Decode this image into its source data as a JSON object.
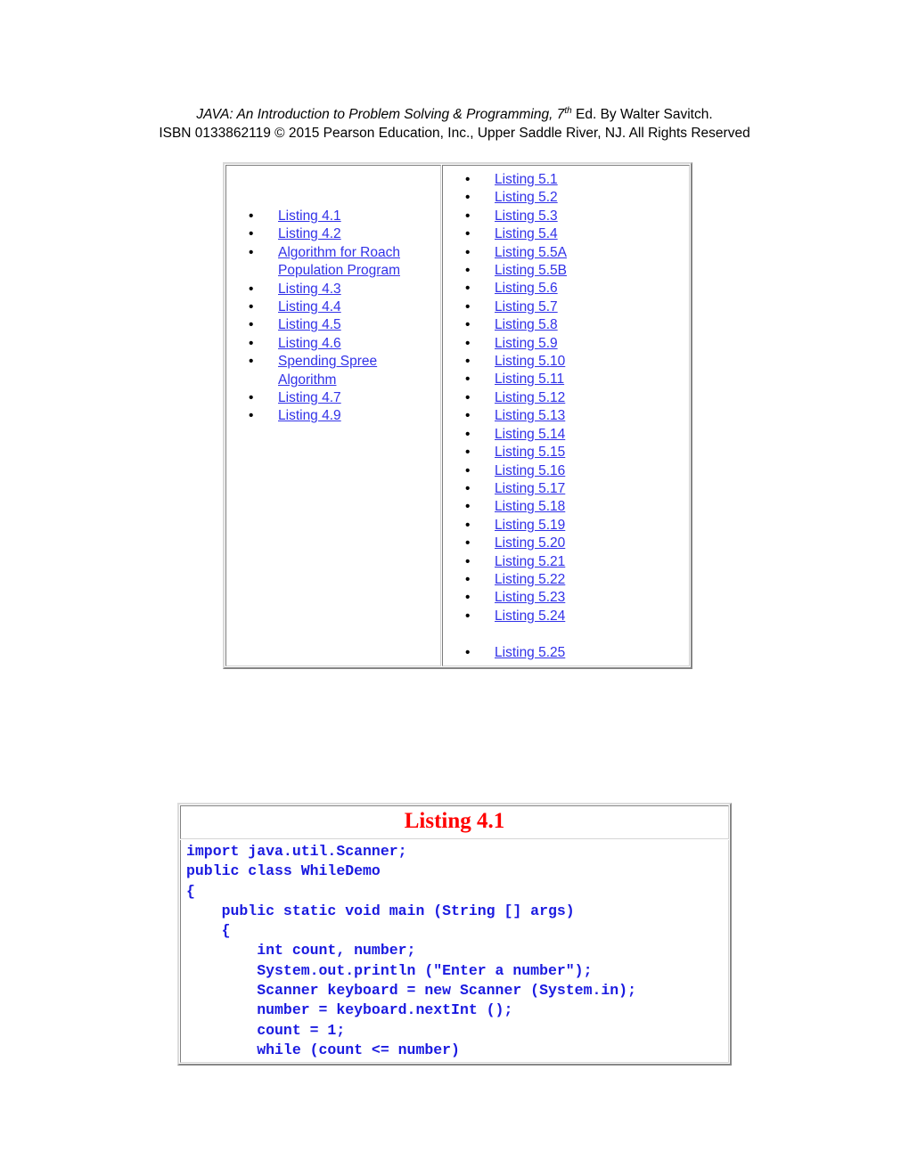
{
  "header": {
    "line1_italic": "JAVA: An Introduction to Problem Solving & Programming,",
    "line1_edition_num": "7",
    "line1_edition_sup": "th",
    "line1_tail": " Ed. By Walter Savitch.",
    "line2": "ISBN 0133862119 © 2015 Pearson Education, Inc., Upper Saddle River, NJ. All Rights Reserved"
  },
  "listings_table": {
    "left_column": [
      {
        "label": "Listing 4.1",
        "bullet": true
      },
      {
        "label": "Listing 4.2",
        "bullet": true
      },
      {
        "label": "Algorithm for Roach Population Program",
        "bullet": true
      },
      {
        "label": "Listing 4.3",
        "bullet": true
      },
      {
        "label": "Listing 4.4",
        "bullet": true
      },
      {
        "label": "Listing 4.5",
        "bullet": true
      },
      {
        "label": "Listing 4.6",
        "bullet": true
      },
      {
        "label": "Spending Spree Algorithm",
        "bullet": true
      },
      {
        "label": "Listing 4.7",
        "bullet": true
      },
      {
        "label": "Listing 4.9",
        "bullet": true
      }
    ],
    "right_column": [
      {
        "label": "Listing 5.1",
        "bullet": true
      },
      {
        "label": "Listing 5.2",
        "bullet": true
      },
      {
        "label": "Listing 5.3",
        "bullet": true
      },
      {
        "label": "Listing 5.4",
        "bullet": true
      },
      {
        "label": "Listing 5.5A",
        "bullet": true
      },
      {
        "label": "Listing 5.5B",
        "bullet": true
      },
      {
        "label": "Listing 5.6",
        "bullet": true
      },
      {
        "label": "Listing 5.7",
        "bullet": true
      },
      {
        "label": "Listing 5.8",
        "bullet": true
      },
      {
        "label": "Listing 5.9",
        "bullet": true
      },
      {
        "label": "Listing 5.10",
        "bullet": true
      },
      {
        "label": "Listing 5.11",
        "bullet": true
      },
      {
        "label": "Listing 5.12",
        "bullet": true
      },
      {
        "label": "Listing 5.13",
        "bullet": true
      },
      {
        "label": "Listing 5.14",
        "bullet": true
      },
      {
        "label": "Listing 5.15",
        "bullet": true
      },
      {
        "label": "Listing 5.16",
        "bullet": true
      },
      {
        "label": "Listing 5.17",
        "bullet": true
      },
      {
        "label": "Listing 5.18",
        "bullet": true
      },
      {
        "label": "Listing 5.19",
        "bullet": true
      },
      {
        "label": "Listing 5.20",
        "bullet": true
      },
      {
        "label": "Listing 5.21",
        "bullet": true
      },
      {
        "label": "Listing 5.22",
        "bullet": true
      },
      {
        "label": "Listing 5.23",
        "bullet": true
      },
      {
        "label": "Listing 5.24",
        "bullet": true
      },
      {
        "label": "",
        "bullet": false
      },
      {
        "label": "Listing 5.25",
        "bullet": true
      }
    ]
  },
  "code_listing": {
    "title": "Listing 4.1",
    "code": "import java.util.Scanner;\npublic class WhileDemo\n{\n    public static void main (String [] args)\n    {\n        int count, number;\n        System.out.println (\"Enter a number\");\n        Scanner keyboard = new Scanner (System.in);\n        number = keyboard.nextInt ();\n        count = 1;\n        while (count <= number)"
  },
  "colors": {
    "link": "#3131e8",
    "code_text": "#1a1ae0",
    "title_red": "#ff0000",
    "page_background": "#ffffff"
  }
}
